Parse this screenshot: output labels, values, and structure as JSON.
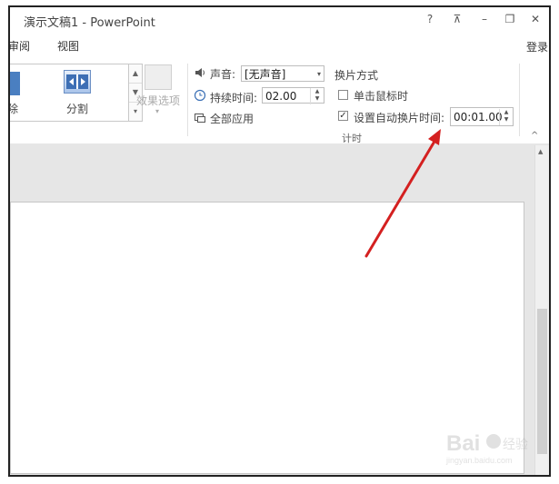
{
  "window": {
    "title": "演示文稿1 - PowerPoint",
    "help": "?",
    "restore_ribbon": "⊼",
    "minimize": "–",
    "maximize": "❐",
    "close": "✕"
  },
  "menu": {
    "items": [
      "审阅",
      "视图"
    ],
    "login": "登录"
  },
  "gallery": {
    "partial_item": "除",
    "split_label": "分割",
    "effects_label": "效果选项"
  },
  "timing": {
    "sound_label": "声音:",
    "sound_value": "[无声音]",
    "duration_label": "持续时间:",
    "duration_value": "02.00",
    "apply_all": "全部应用",
    "advance_title": "换片方式",
    "on_click_label": "单击鼠标时",
    "on_click_checked": false,
    "auto_label": "设置自动换片时间:",
    "auto_checked": true,
    "auto_value": "00:01.00",
    "group_label": "计时"
  },
  "colors": {
    "arrow": "#d42020",
    "accent": "#2b579a"
  },
  "watermark": "Baidu经验 jingyan.baidu.com"
}
